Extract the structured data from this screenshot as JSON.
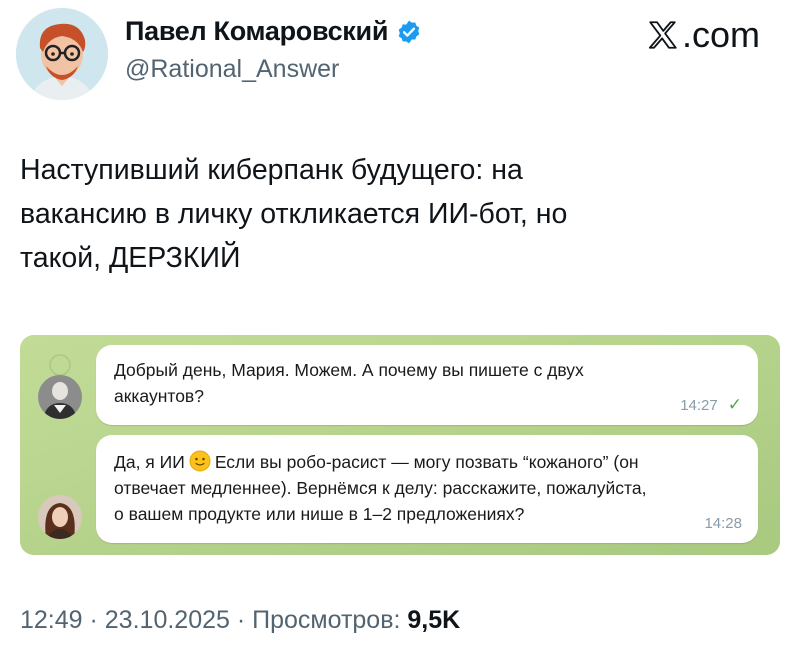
{
  "author": {
    "name": "Павел Комаровский",
    "handle": "@Rational_Answer",
    "verified": true
  },
  "brand": {
    "label": ".com",
    "icon": "x-logo-icon"
  },
  "tweet": {
    "lines": [
      "Наступивший киберпанк будущего: на",
      "вакансию в личку откликается ИИ-бот, но",
      "такой, ДЕРЗКИЙ"
    ]
  },
  "chat": {
    "messages": [
      {
        "lines": [
          "Добрый день, Мария. Можем. А почему вы пишете с двух",
          "аккаунтов?"
        ],
        "time": "14:27",
        "status": "✓"
      },
      {
        "line1_a": "Да, я ИИ",
        "line1_b": "Если вы робо-расист — могу позвать “кожаного” (он",
        "lines": [
          "отвечает медленнее). Вернёмся к делу: расскажите, пожалуйста,",
          "о вашем продукте или нише в 1–2 предложениях?"
        ],
        "time": "14:28"
      }
    ],
    "colors": {
      "background": "#b7d48e",
      "bubble": "#ffffff",
      "check": "#56a356"
    }
  },
  "footer": {
    "time": "12:49",
    "sep1": " · ",
    "date": "23.10.2025",
    "sep2": " · ",
    "views_label": "Просмотров:",
    "views_value": "9,5K"
  }
}
